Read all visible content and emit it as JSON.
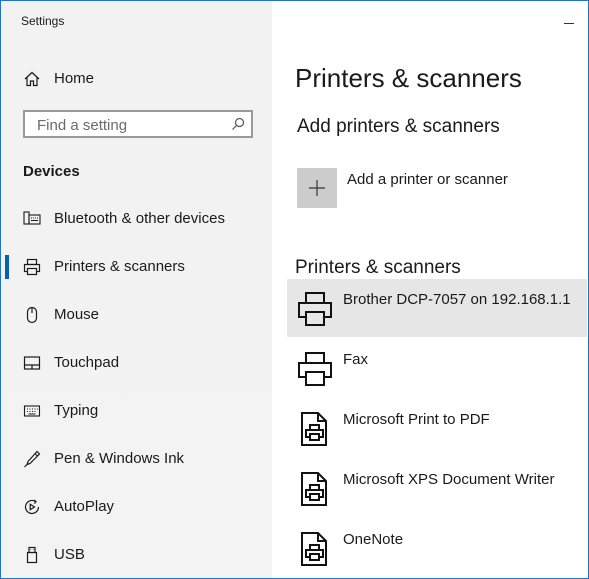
{
  "window": {
    "title": "Settings"
  },
  "sidebar": {
    "home_label": "Home",
    "search_placeholder": "Find a setting",
    "section_label": "Devices",
    "items": [
      {
        "label": "Bluetooth & other devices",
        "icon": "bluetooth-devices-icon",
        "selected": false
      },
      {
        "label": "Printers & scanners",
        "icon": "printer-icon",
        "selected": true
      },
      {
        "label": "Mouse",
        "icon": "mouse-icon",
        "selected": false
      },
      {
        "label": "Touchpad",
        "icon": "touchpad-icon",
        "selected": false
      },
      {
        "label": "Typing",
        "icon": "keyboard-icon",
        "selected": false
      },
      {
        "label": "Pen & Windows Ink",
        "icon": "pen-icon",
        "selected": false
      },
      {
        "label": "AutoPlay",
        "icon": "autoplay-icon",
        "selected": false
      },
      {
        "label": "USB",
        "icon": "usb-icon",
        "selected": false
      }
    ]
  },
  "main": {
    "page_title": "Printers & scanners",
    "add_section_title": "Add printers & scanners",
    "add_button_label": "Add a printer or scanner",
    "list_title": "Printers & scanners",
    "printers": [
      {
        "label": "Brother DCP-7057 on 192.168.1.1",
        "icon": "printer-icon",
        "selected": true
      },
      {
        "label": "Fax",
        "icon": "printer-icon",
        "selected": false
      },
      {
        "label": "Microsoft Print to PDF",
        "icon": "document-printer-icon",
        "selected": false
      },
      {
        "label": "Microsoft XPS Document Writer",
        "icon": "document-printer-icon",
        "selected": false
      },
      {
        "label": "OneNote",
        "icon": "document-printer-icon",
        "selected": false
      }
    ]
  },
  "colors": {
    "accent": "#0063b1",
    "sidebar_bg": "#f2f2f2",
    "selected_bg": "#e6e6e6",
    "window_border": "#1f73c9"
  }
}
